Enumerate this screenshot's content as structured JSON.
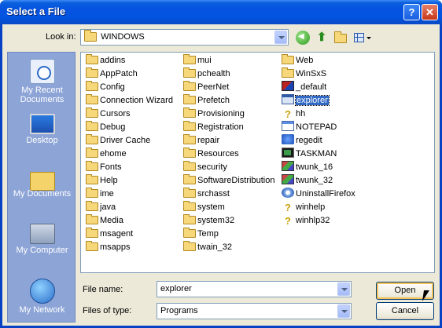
{
  "window": {
    "title": "Select a File",
    "help_glyph": "?",
    "close_glyph": "✕"
  },
  "lookin": {
    "label": "Look in:",
    "value": "WINDOWS"
  },
  "toolbar": {
    "up_glyph": "⬆"
  },
  "places": [
    {
      "label": "My Recent Documents",
      "icon": "recent-documents-icon"
    },
    {
      "label": "Desktop",
      "icon": "desktop-icon"
    },
    {
      "label": "My Documents",
      "icon": "my-documents-icon"
    },
    {
      "label": "My Computer",
      "icon": "my-computer-icon"
    },
    {
      "label": "My Network",
      "icon": "my-network-icon"
    }
  ],
  "files": {
    "col1": [
      "addins",
      "AppPatch",
      "Config",
      "Connection Wizard",
      "Cursors",
      "Debug",
      "Driver Cache",
      "ehome",
      "Fonts",
      "Help",
      "ime",
      "java",
      "Media",
      "msagent",
      "msapps"
    ],
    "col2": [
      "mui",
      "pchealth",
      "PeerNet",
      "Prefetch",
      "Provisioning",
      "Registration",
      "repair",
      "Resources",
      "security",
      "SoftwareDistribution",
      "srchasst",
      "system",
      "system32",
      "Temp",
      "twain_32"
    ],
    "col3": [
      {
        "name": "Web",
        "icon": "folder"
      },
      {
        "name": "WinSxS",
        "icon": "folder"
      },
      {
        "name": "_default",
        "icon": "default"
      },
      {
        "name": "explorer",
        "icon": "exe",
        "selected": true
      },
      {
        "name": "hh",
        "icon": "help"
      },
      {
        "name": "NOTEPAD",
        "icon": "note"
      },
      {
        "name": "regedit",
        "icon": "reg"
      },
      {
        "name": "TASKMAN",
        "icon": "term"
      },
      {
        "name": "twunk_16",
        "icon": "multi"
      },
      {
        "name": "twunk_32",
        "icon": "multi"
      },
      {
        "name": "UninstallFirefox",
        "icon": "disc"
      },
      {
        "name": "winhelp",
        "icon": "help"
      },
      {
        "name": "winhlp32",
        "icon": "help"
      }
    ]
  },
  "filename": {
    "label": "File name:",
    "value": "explorer"
  },
  "filetype": {
    "label": "Files of type:",
    "value": "Programs"
  },
  "buttons": {
    "open": "Open",
    "cancel": "Cancel"
  }
}
